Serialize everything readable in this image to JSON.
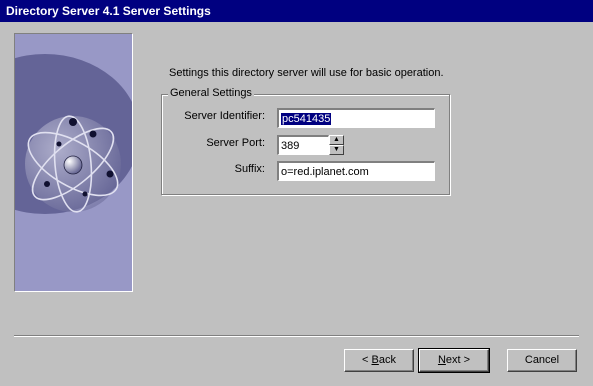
{
  "window": {
    "title": "Directory Server 4.1 Server Settings"
  },
  "intro": "Settings this directory server will use for basic operation.",
  "group": {
    "label": "General Settings",
    "server_identifier_label": "Server Identifier:",
    "server_identifier_value": "pc541435",
    "server_port_label": "Server Port:",
    "server_port_value": "389",
    "suffix_label": "Suffix:",
    "suffix_value": "o=red.iplanet.com"
  },
  "buttons": {
    "back": {
      "prefix": "< ",
      "mnemonic": "B",
      "rest": "ack"
    },
    "next": {
      "mnemonic": "N",
      "rest": "ext >"
    },
    "cancel": "Cancel"
  },
  "colors": {
    "titlebar": "#000080",
    "face": "#c0c0c0",
    "selection": "#000080"
  }
}
